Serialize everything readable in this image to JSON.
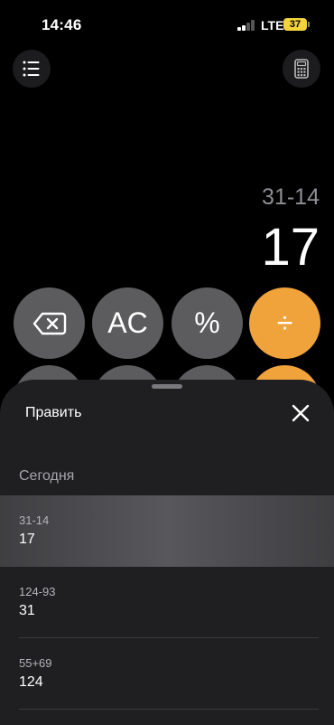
{
  "status_bar": {
    "time": "14:46",
    "network": "LTE",
    "battery_level": "37",
    "battery_color": "#f5d33a"
  },
  "toolbar": {
    "menu_icon": "list-icon",
    "calculator_icon": "calculator-icon"
  },
  "display": {
    "expression": "31-14",
    "result": "17"
  },
  "keypad": {
    "backspace_icon": "backspace-icon",
    "clear_label": "AC",
    "percent_label": "%",
    "divide_label": "÷",
    "operator_color": "#f1a33b"
  },
  "history_sheet": {
    "edit_label": "Править",
    "close_icon": "close-icon",
    "section_title": "Сегодня",
    "items": [
      {
        "expression": "31-14",
        "result": "17",
        "selected": true
      },
      {
        "expression": "124-93",
        "result": "31",
        "selected": false
      },
      {
        "expression": "55+69",
        "result": "124",
        "selected": false
      }
    ]
  }
}
